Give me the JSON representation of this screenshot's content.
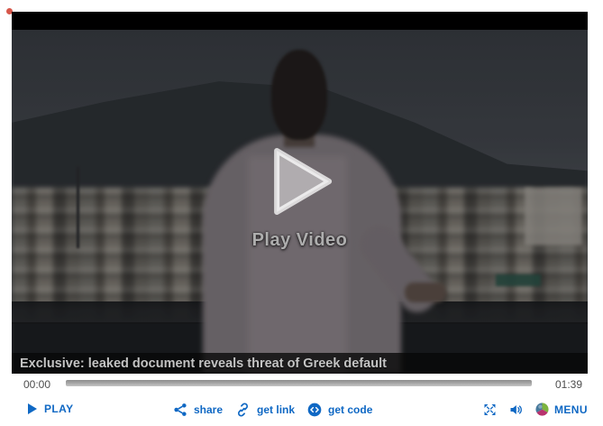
{
  "player": {
    "caption": "Exclusive: leaked document reveals threat of Greek default",
    "overlay_label": "Play Video"
  },
  "progress": {
    "elapsed": "00:00",
    "duration": "01:39",
    "percent": 0
  },
  "controls": {
    "play": "PLAY",
    "share": "share",
    "get_link": "get link",
    "get_code": "get code",
    "menu": "MENU"
  },
  "colors": {
    "accent_blue": "#0f68c4",
    "progress_gray": "#a4a4a4",
    "caption_text": "#c4c4c4",
    "menu_icon_green": "#7db43f",
    "menu_icon_magenta": "#b8336e",
    "menu_icon_blue": "#47799c",
    "red_indicator": "#d03a2a"
  },
  "icons": {
    "red_dot": "record-dot",
    "big_play": "play-triangle",
    "play": "play-triangle",
    "share": "share-nodes",
    "get_link": "chain-link",
    "get_code": "code-brackets-circle",
    "fullscreen": "expand-arrows",
    "volume": "speaker-waves",
    "menu": "pinwheel-sphere"
  }
}
